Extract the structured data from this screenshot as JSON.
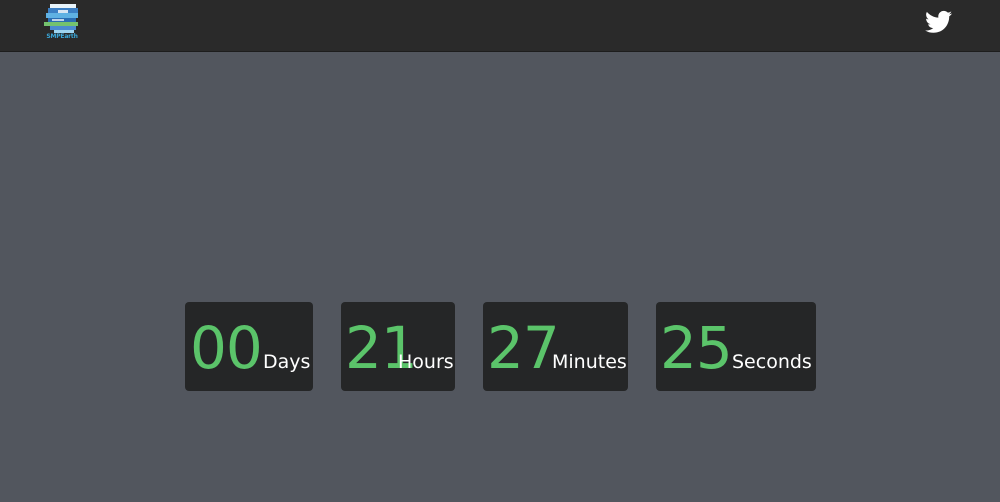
{
  "header": {
    "logo_text": "SMPEarth",
    "social_icon": "twitter-icon"
  },
  "countdown": {
    "days": {
      "value": "00",
      "label": "Days"
    },
    "hours": {
      "value": "21",
      "label": "Hours"
    },
    "minutes": {
      "value": "27",
      "label": "Minutes"
    },
    "seconds": {
      "value": "25",
      "label": "Seconds"
    }
  },
  "colors": {
    "background": "#52565e",
    "navbar": "#2a2a2a",
    "box": "#252627",
    "number": "#5bc46a",
    "label": "#ffffff"
  }
}
